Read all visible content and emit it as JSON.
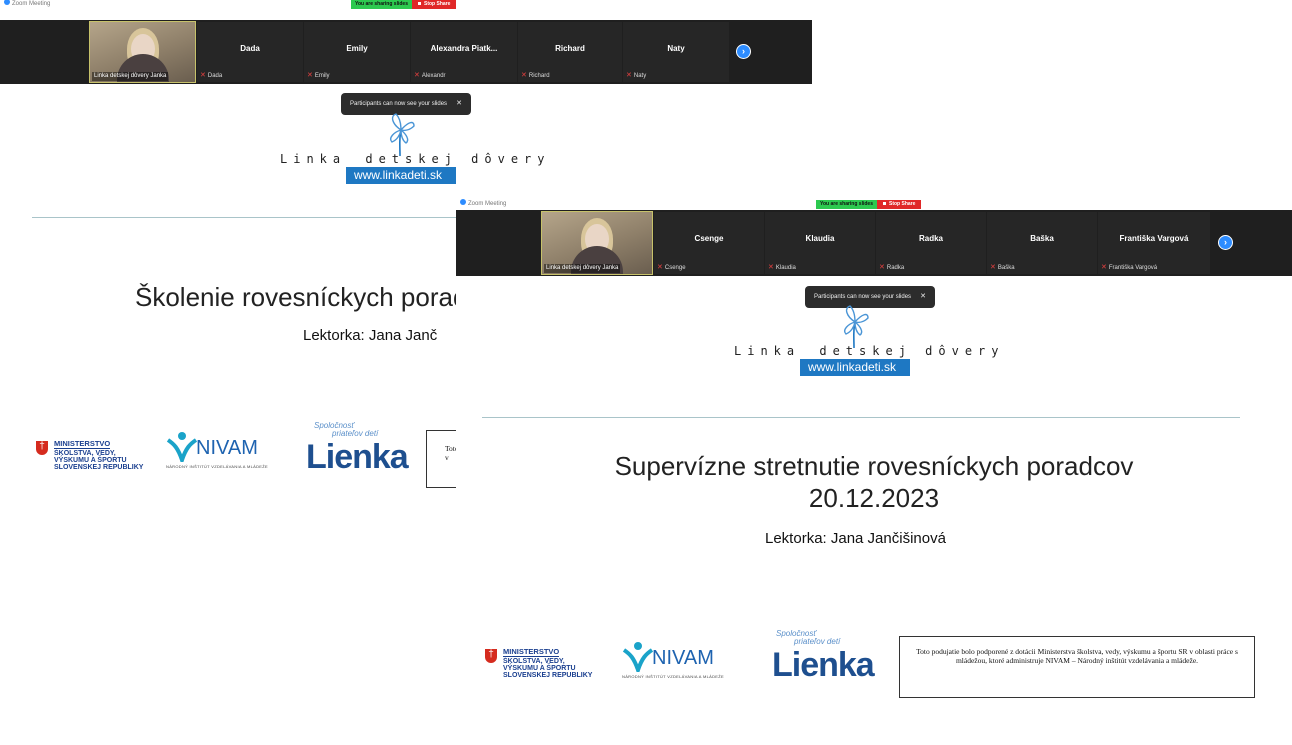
{
  "back_window": {
    "title": "Zoom Meeting",
    "sharing_label": "You are sharing slides",
    "stop_share_label": "Stop Share",
    "host_tag": "Linka detskej dôvery Janka",
    "participants": [
      {
        "name": "Dada",
        "tag": "Dada"
      },
      {
        "name": "Emily",
        "tag": "Emily"
      },
      {
        "name": "Alexandra  Piatk...",
        "tag": "Alexandr"
      },
      {
        "name": "Richard",
        "tag": "Richard"
      },
      {
        "name": "Naty",
        "tag": "Naty"
      }
    ],
    "toast": "Participants can now see your slides",
    "slide": {
      "title": "Školenie rovesníckych porad",
      "lecturer": "Lektorka: Jana Janč",
      "notice_fragment": "Toto podujatie\nv"
    }
  },
  "front_window": {
    "title": "Zoom Meeting",
    "sharing_label": "You are sharing slides",
    "stop_share_label": "Stop Share",
    "host_tag": "Linka detskej dôvery Janka",
    "participants": [
      {
        "name": "Csenge",
        "tag": "Csenge"
      },
      {
        "name": "Klaudia",
        "tag": "Klaudia"
      },
      {
        "name": "Radka",
        "tag": "Radka"
      },
      {
        "name": "Baška",
        "tag": "Baška"
      },
      {
        "name": "Františka Vargová",
        "tag": "Františka Vargová"
      }
    ],
    "toast": "Participants can now see your slides",
    "slide": {
      "title_line1": "Supervízne stretnutie rovesníckych poradcov",
      "title_line2": "20.12.2023",
      "lecturer": "Lektorka: Jana Jančišinová",
      "notice": "Toto podujatie bolo podporené z dotácii Ministerstva školstva, vedy, výskumu a športu SR v oblasti práce s mládežou, ktoré administruje NIVAM – Národný inštitút vzdelávania a mládeže."
    }
  },
  "brand": {
    "wordmark_left": "Linka",
    "wordmark_right": "detskej dôvery",
    "url": "www.linkadeti.sk"
  },
  "logos": {
    "ministry_line1": "MINISTERSTVO",
    "ministry_line2": "ŠKOLSTVA, VEDY,",
    "ministry_line3": "VÝSKUMU A ŠPORTU",
    "ministry_line4": "SLOVENSKEJ REPUBLIKY",
    "nivam": "NIVAM",
    "nivam_sub": "NÁRODNÝ INŠTITÚT VZDELÁVANIA A MLÁDEŽE",
    "lienka_top": "Spoločnosť",
    "lienka_mid": "priateľov detí",
    "lienka_name": "Lienka"
  },
  "icons": {
    "next": "chevron-right-icon",
    "mic": "mic-muted-icon",
    "close": "close-icon"
  },
  "colors": {
    "zoom_blue": "#2d8cff",
    "sharing_green": "#2cc94f",
    "stop_red": "#e02828",
    "brand_blue": "#1e78c3"
  }
}
